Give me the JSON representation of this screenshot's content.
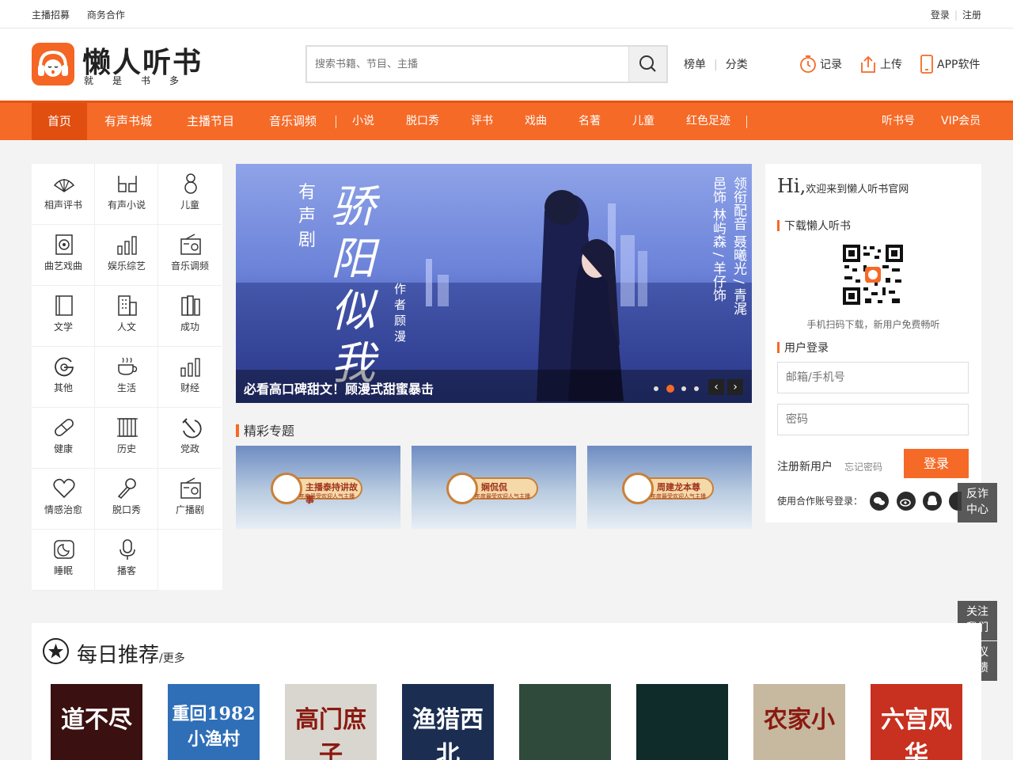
{
  "topbar": {
    "left": [
      "主播招募",
      "商务合作"
    ],
    "login": "登录",
    "register": "注册"
  },
  "header": {
    "logo_title": "懒人听书",
    "logo_sub": "就是书多",
    "search_placeholder": "搜索书籍、节目、主播",
    "links": [
      "榜单",
      "分类"
    ],
    "actions": [
      {
        "label": "记录",
        "icon": "history-clock-icon"
      },
      {
        "label": "上传",
        "icon": "upload-icon"
      },
      {
        "label": "APP软件",
        "icon": "phone-icon"
      }
    ]
  },
  "nav": {
    "main": [
      "首页",
      "有声书城",
      "主播节目",
      "音乐调频"
    ],
    "sub": [
      "小说",
      "脱口秀",
      "评书",
      "戏曲",
      "名著",
      "儿童",
      "红色足迹"
    ],
    "right": [
      "听书号",
      "VIP会员"
    ]
  },
  "categories": [
    {
      "label": "相声评书",
      "icon": "fan-icon"
    },
    {
      "label": "有声小说",
      "icon": "headphones-icon"
    },
    {
      "label": "儿童",
      "icon": "child-icon"
    },
    {
      "label": "曲艺戏曲",
      "icon": "speaker-icon"
    },
    {
      "label": "娱乐综艺",
      "icon": "bar-chart-icon"
    },
    {
      "label": "音乐调频",
      "icon": "radio-icon"
    },
    {
      "label": "文学",
      "icon": "book-icon"
    },
    {
      "label": "人文",
      "icon": "building-icon"
    },
    {
      "label": "成功",
      "icon": "books-icon"
    },
    {
      "label": "其他",
      "icon": "g-circle-icon"
    },
    {
      "label": "生活",
      "icon": "coffee-cup-icon"
    },
    {
      "label": "财经",
      "icon": "bar-chart-icon"
    },
    {
      "label": "健康",
      "icon": "pill-icon"
    },
    {
      "label": "历史",
      "icon": "scroll-icon"
    },
    {
      "label": "党政",
      "icon": "hammer-sickle-icon"
    },
    {
      "label": "情感治愈",
      "icon": "heart-icon"
    },
    {
      "label": "脱口秀",
      "icon": "microphone-icon"
    },
    {
      "label": "广播剧",
      "icon": "radio-icon"
    },
    {
      "label": "睡眠",
      "icon": "moon-icon"
    },
    {
      "label": "播客",
      "icon": "podcast-mic-icon"
    }
  ],
  "banner": {
    "caption": "必看高口碑甜文！顾漫式甜蜜暴击",
    "tag": "有声剧",
    "title": "骄阳似我",
    "author": "作者 顾漫",
    "cast": "领衔配音 聂曦光 / 青浘邑饰 林屿森 / 羊仔饰"
  },
  "topics": {
    "title": "精彩专题",
    "items": [
      {
        "name": "主播泰持讲故事",
        "sub": "年度最受欢迎人气主播"
      },
      {
        "name": "娴侃侃",
        "sub": "年度最受欢迎人气主播"
      },
      {
        "name": "周建龙本尊",
        "sub": "年度最受欢迎人气主播"
      }
    ]
  },
  "panel": {
    "hi": "Hi,",
    "welcome": "欢迎来到懒人听书官网",
    "download_title": "下载懒人听书",
    "qr_tip": "手机扫码下载，新用户免费畅听",
    "login_title": "用户登录",
    "email_placeholder": "邮箱/手机号",
    "password_placeholder": "密码",
    "register": "注册新用户",
    "forgot": "忘记密码",
    "login_button": "登录",
    "oauth_label": "使用合作账号登录："
  },
  "float": {
    "anti_fraud": [
      "反诈",
      "中心"
    ],
    "follow": [
      "关注",
      "我们"
    ],
    "feedback": [
      "建议",
      "反馈"
    ]
  },
  "daily": {
    "title": "每日推荐",
    "more": "/更多",
    "books": [
      {
        "title": "道不尽",
        "color": "#3a1010"
      },
      {
        "title": "重回1982小渔村",
        "color": "#2f6fb8"
      },
      {
        "title": "高门庶子",
        "color": "#d9d6d0"
      },
      {
        "title": "渔猎西北",
        "color": "#1b2e52"
      },
      {
        "title": "",
        "color": "#2f4a3a"
      },
      {
        "title": "",
        "color": "#0f2b2a"
      },
      {
        "title": "农家小",
        "color": "#c7b8a0"
      },
      {
        "title": "六宫风华",
        "color": "#c8301f"
      }
    ]
  }
}
